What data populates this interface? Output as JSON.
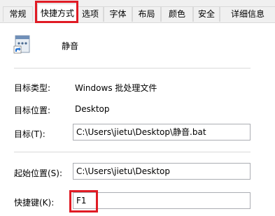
{
  "tabs": [
    {
      "label": "常规"
    },
    {
      "label": "快捷方式"
    },
    {
      "label": "选项"
    },
    {
      "label": "字体"
    },
    {
      "label": "布局"
    },
    {
      "label": "颜色"
    },
    {
      "label": "安全"
    },
    {
      "label": "详细信息"
    }
  ],
  "shortcut": {
    "name": "静音",
    "icon": "batch-file-shortcut-icon",
    "target_type_label": "目标类型:",
    "target_type_value": "Windows 批处理文件",
    "target_location_label": "目标位置:",
    "target_location_value": "Desktop",
    "target_label": "目标(T):",
    "target_value": "C:\\Users\\jietu\\Desktop\\静音.bat",
    "start_in_label": "起始位置(S):",
    "start_in_value": "C:\\Users\\jietu\\Desktop",
    "hotkey_label": "快捷键(K):",
    "hotkey_value": "F1"
  },
  "colors": {
    "highlight": "#e01b24",
    "tab_bg": "#f0f0f0",
    "border": "#d9d9d9"
  }
}
